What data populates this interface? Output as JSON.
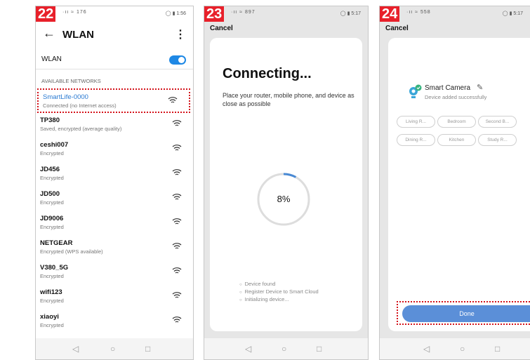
{
  "panels": {
    "wlan": {
      "step": "22",
      "status_left": "·ıı ≈ 176",
      "status_right": "◯ ▮ 1:56",
      "title": "WLAN",
      "toggle_label": "WLAN",
      "toggle_on": true,
      "section_label": "AVAILABLE NETWORKS",
      "networks": [
        {
          "name": "SmartLife-0000",
          "status": "Connected (no Internet access)"
        },
        {
          "name": "TP380",
          "status": "Saved, encrypted (average quality)"
        },
        {
          "name": "ceshi007",
          "status": "Encrypted"
        },
        {
          "name": "JD456",
          "status": "Encrypted"
        },
        {
          "name": "JD500",
          "status": "Encrypted"
        },
        {
          "name": "JD9006",
          "status": "Encrypted"
        },
        {
          "name": "NETGEAR",
          "status": "Encrypted (WPS available)"
        },
        {
          "name": "V380_5G",
          "status": "Encrypted"
        },
        {
          "name": "wifi123",
          "status": "Encrypted"
        },
        {
          "name": "xiaoyi",
          "status": "Encrypted"
        }
      ]
    },
    "connecting": {
      "step": "23",
      "status_left": "·ıı ≈ 897",
      "status_right": "◯ ▮ 5:17",
      "cancel": "Cancel",
      "title": "Connecting...",
      "description": "Place your router, mobile phone, and device as close as possible",
      "progress_percent": 8,
      "progress_label": "8%",
      "steps": [
        "Device found",
        "Register Device to Smart Cloud",
        "Initializing device..."
      ]
    },
    "added": {
      "step": "24",
      "status_left": "·ıı ≈ 558",
      "status_right": "◯ ▮ 5:17",
      "cancel": "Cancel",
      "device_name": "Smart Camera",
      "device_status": "Device added successfully",
      "rooms": [
        "Living R...",
        "Bedroom",
        "Second B...",
        "Dining R...",
        "Kitchen",
        "Study R..."
      ],
      "done_label": "Done"
    }
  },
  "navbar": {
    "back": "◁",
    "home": "○",
    "recent": "□"
  },
  "colors": {
    "accent": "#1e88e5",
    "highlight": "#d4131b",
    "badge": "#e8202a",
    "done": "#5b8fd8"
  }
}
